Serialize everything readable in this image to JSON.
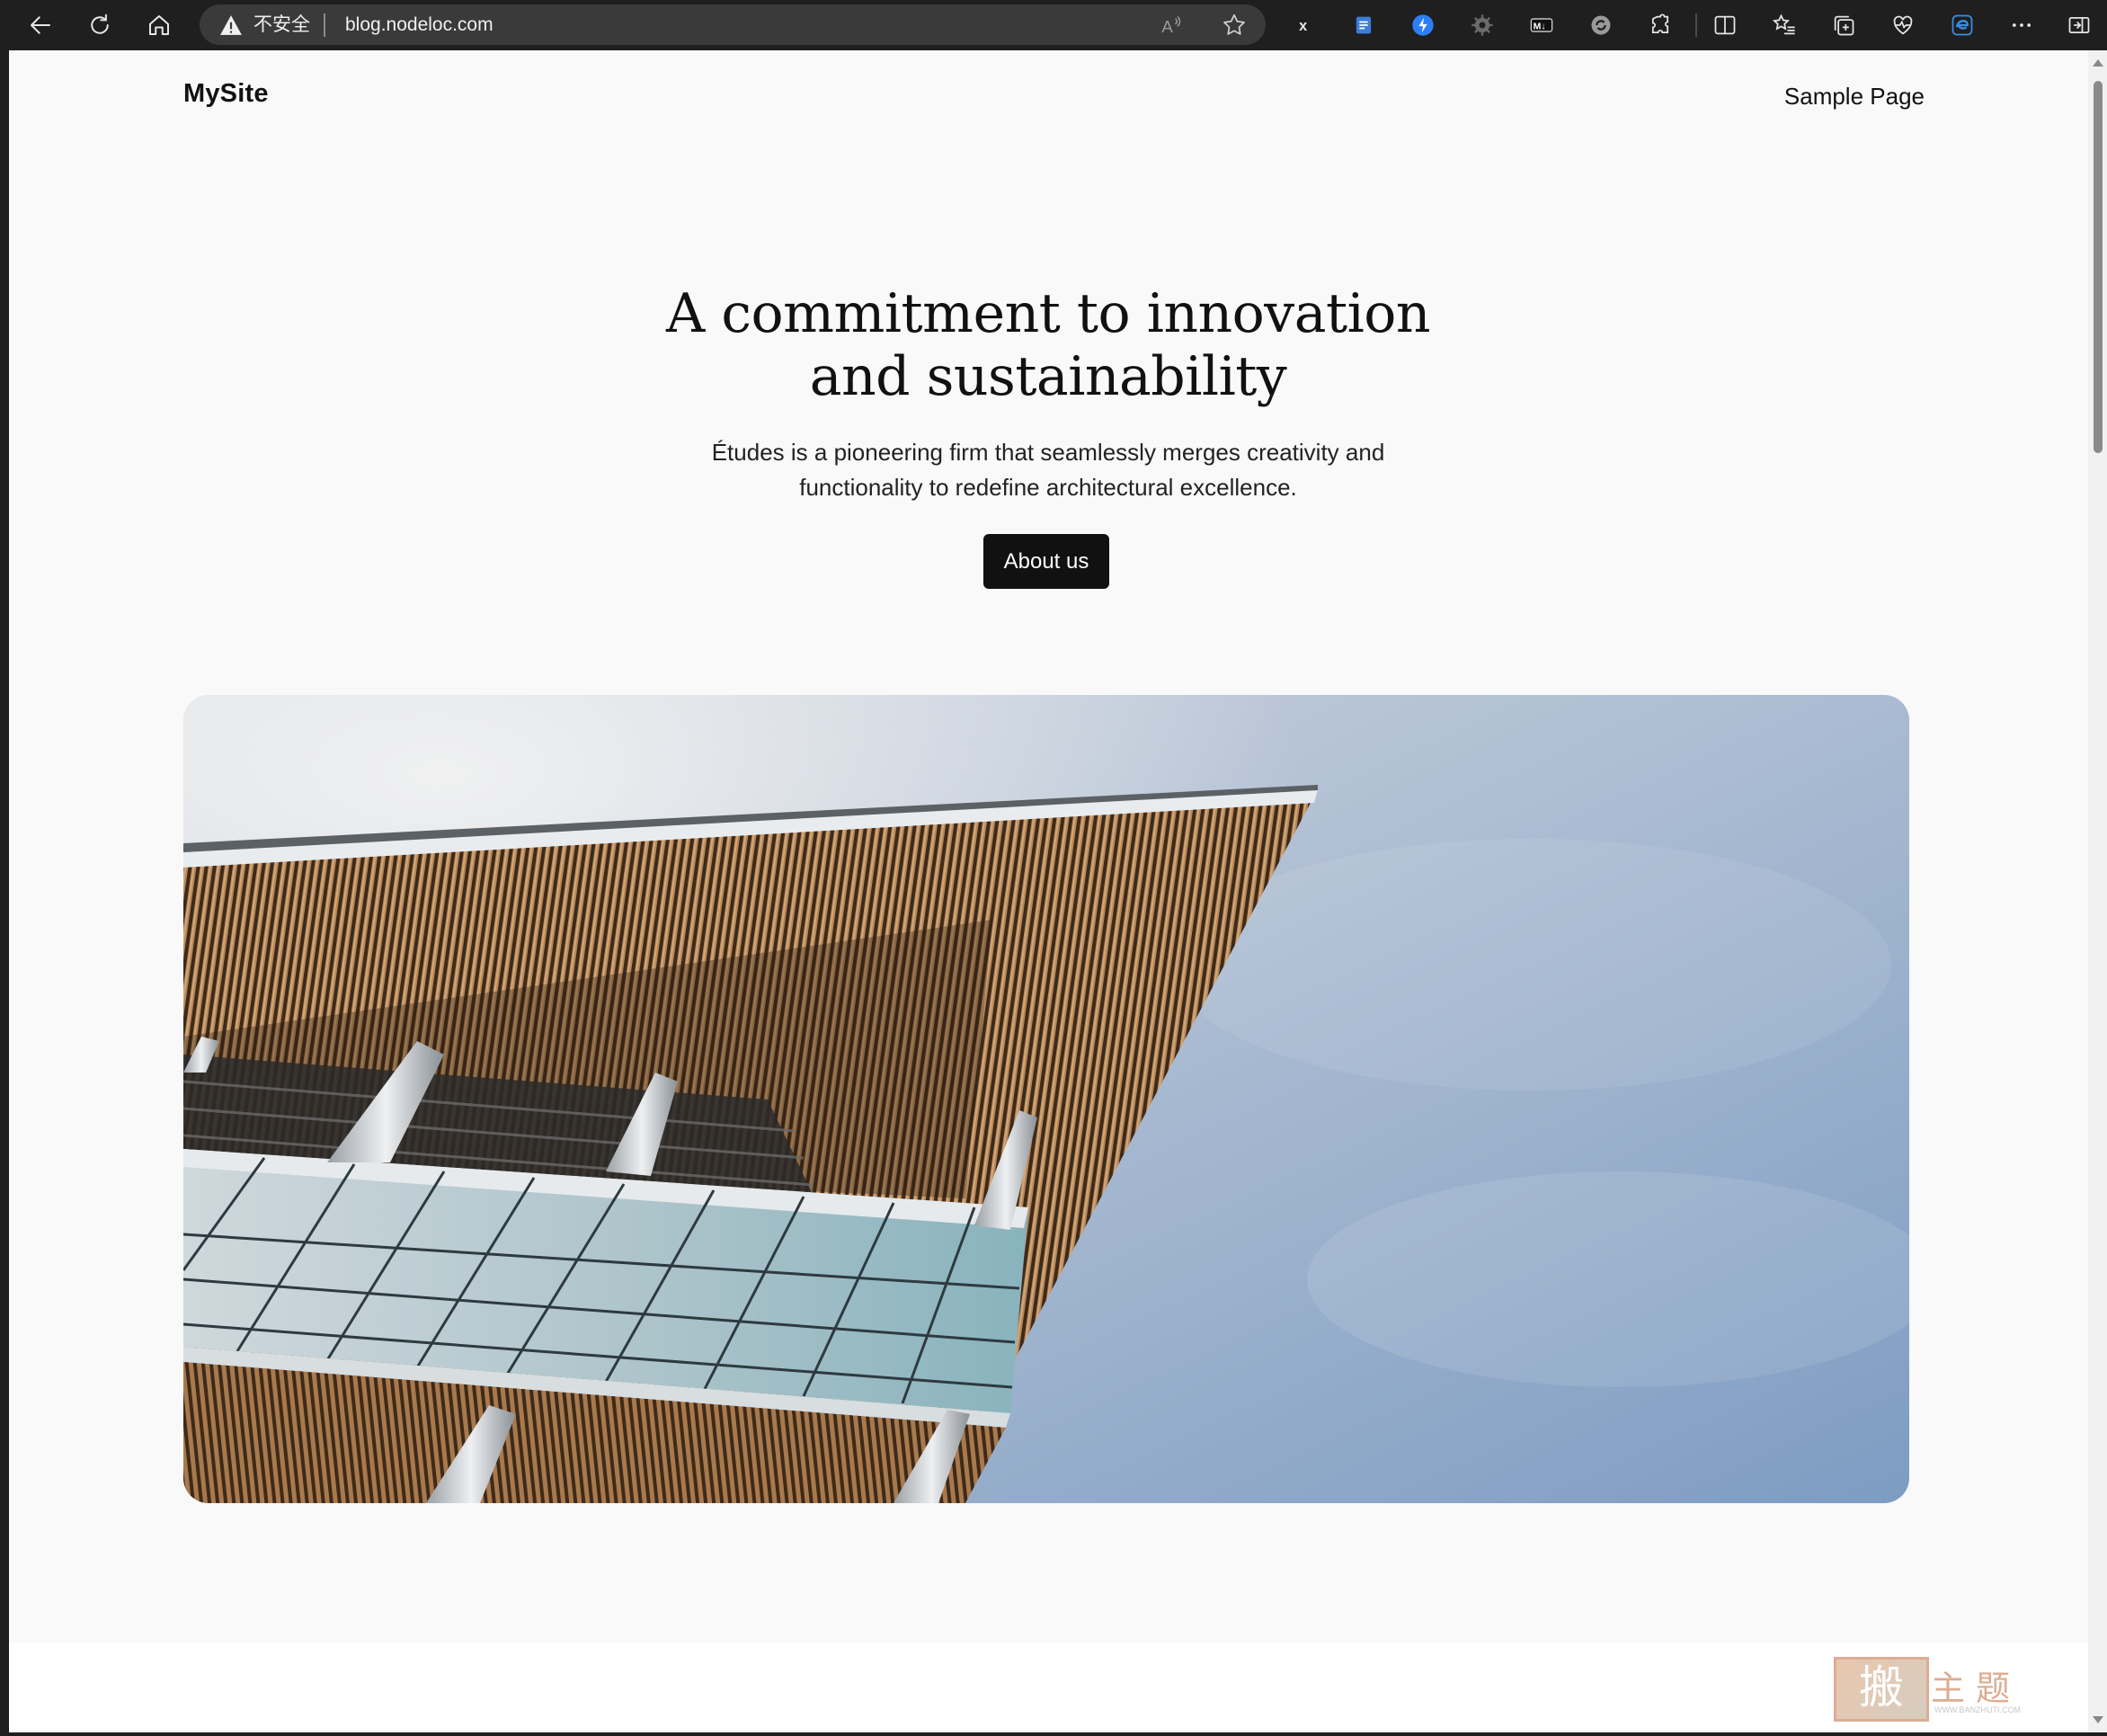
{
  "browser": {
    "security_label": "不安全",
    "url": "blog.nodeloc.com",
    "icons": {
      "back": "back-arrow-icon",
      "refresh": "refresh-icon",
      "home": "home-icon",
      "warning": "warning-triangle-icon",
      "read_aloud": "read-aloud-icon",
      "favorite": "favorite-star-icon",
      "menu": "more-options-icon"
    },
    "extensions": [
      "x-extension-icon",
      "translate-extension-icon",
      "lightning-extension-icon",
      "gear-extension-icon",
      "markdown-extension-icon",
      "sync-extension-icon",
      "extensions-puzzle-icon",
      "split-screen-icon",
      "favorites-list-icon",
      "collections-icon",
      "browser-essentials-icon",
      "edge-icon",
      "more-options-icon",
      "sidebar-toggle-icon"
    ],
    "extension_labels": {
      "x": "x",
      "markdown": "M↓"
    }
  },
  "site": {
    "title": "MySite",
    "nav": {
      "sample_page": "Sample Page"
    }
  },
  "hero": {
    "heading_line1": "A commitment to innovation",
    "heading_line2": "and sustainability",
    "body_line1": "Études is a pioneering firm that seamlessly merges creativity and",
    "body_line2": "functionality to redefine architectural excellence.",
    "button": "About us",
    "image_alt": "architecture-photo"
  },
  "watermark": {
    "box_char": "搬",
    "text": "主题",
    "sub": "WWW.BANZHUTI.COM"
  },
  "colors": {
    "toolbar_bg": "#1f1f1f",
    "address_bg": "#3a3a3a",
    "page_bg": "#f9f9f9",
    "text": "#111111",
    "button_bg": "#111111",
    "button_text": "#ffffff",
    "sky": "#8fa8c8",
    "wood": "#8a5a30"
  }
}
